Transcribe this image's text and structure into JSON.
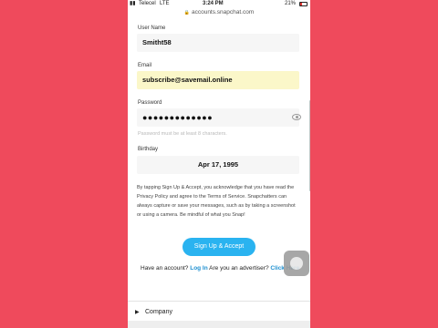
{
  "status_bar": {
    "carrier": "Telecel",
    "network": "LTE",
    "time": "3:24 PM",
    "battery": "21%"
  },
  "browser": {
    "url": "accounts.snapchat.com"
  },
  "form": {
    "username_label": "User Name",
    "username_value": "Smitht58",
    "email_label": "Email",
    "email_value": "subscribe@savemail.online",
    "password_label": "Password",
    "password_value": "●●●●●●●●●●●●●",
    "password_hint": "Password must be at least 8 characters.",
    "birthday_label": "Birthday",
    "birthday_value": "Apr 17, 1995",
    "terms_text": "By tapping Sign Up & Accept, you acknowledge that you have read the Privacy Policy and agree to the Terms of Service. Snapchatters can always capture or save your messages, such as by taking a screenshot or using a camera. Be mindful of what you Snap!",
    "submit_label": "Sign Up & Accept"
  },
  "footer_links": {
    "have_account": "Have an account?",
    "login": "Log In",
    "advertiser": "Are you an advertiser?",
    "click_here": "Click Here"
  },
  "footer_section": {
    "company": "Company"
  },
  "colors": {
    "background": "#ef4a5c",
    "accent": "#2ab3f0",
    "link": "#1d8fd0",
    "autofill": "#fbf7c9"
  }
}
